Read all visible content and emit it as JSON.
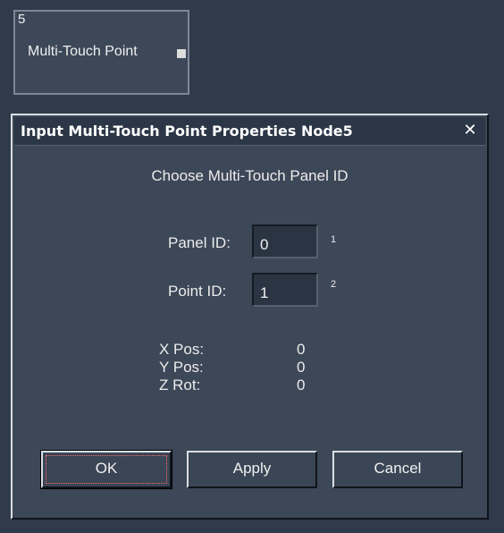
{
  "node": {
    "number": "5",
    "label": "Multi-Touch Point"
  },
  "dialog": {
    "title": "Input Multi-Touch Point Properties Node5",
    "close_glyph": "✕",
    "heading": "Choose Multi-Touch Panel ID",
    "panel_id": {
      "label": "Panel ID:",
      "value": "0",
      "index": "1"
    },
    "point_id": {
      "label": "Point ID:",
      "value": "1",
      "index": "2"
    },
    "info": [
      {
        "label": "X Pos:",
        "value": "0"
      },
      {
        "label": "Y Pos:",
        "value": "0"
      },
      {
        "label": "Z Rot:",
        "value": "0"
      }
    ],
    "buttons": {
      "ok": "OK",
      "apply": "Apply",
      "cancel": "Cancel"
    }
  },
  "colors": {
    "background": "#2f3a4a",
    "panel": "#3c4757",
    "title_bar": "#2b3646"
  }
}
